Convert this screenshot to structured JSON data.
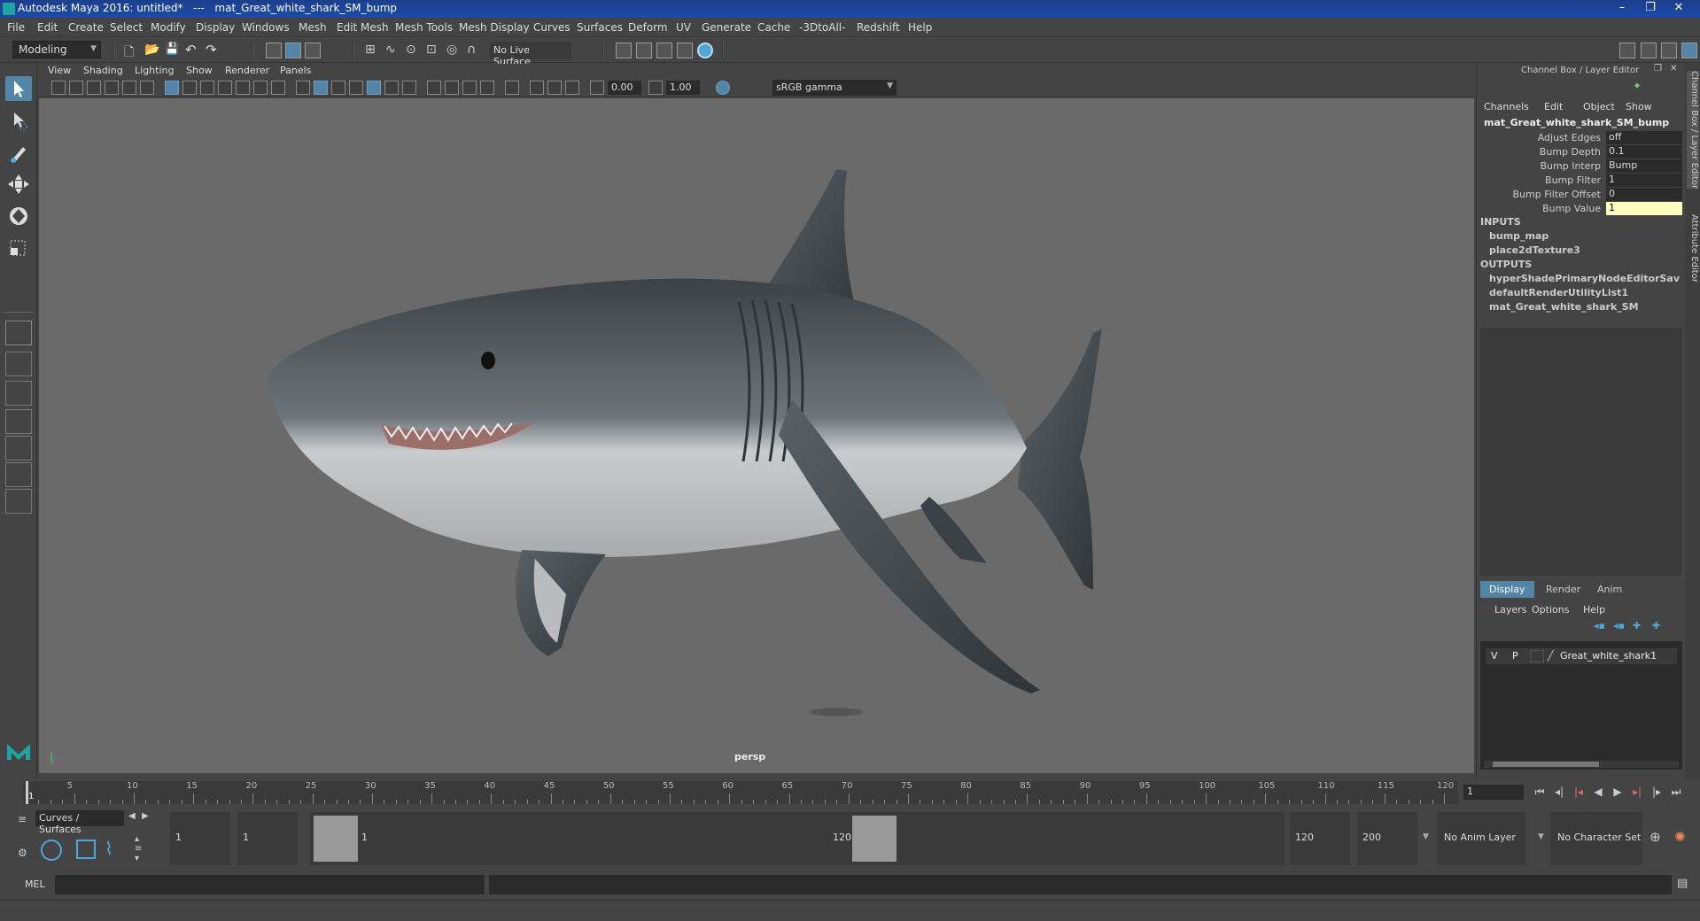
{
  "window": {
    "title": "Autodesk Maya 2016: untitled*   ---   mat_Great_white_shark_SM_bump",
    "minimize": "–",
    "restore": "❐",
    "close": "✕"
  },
  "menubar": [
    "File",
    "Edit",
    "Create",
    "Select",
    "Modify",
    "Display",
    "Windows",
    "Mesh",
    "Edit Mesh",
    "Mesh Tools",
    "Mesh Display",
    "Curves",
    "Surfaces",
    "Deform",
    "UV",
    "Generate",
    "Cache",
    "-3DtoAll-",
    "Redshift",
    "Help"
  ],
  "status": {
    "mode": "Modeling",
    "live_surface": "No Live Surface"
  },
  "panel_menu": [
    "View",
    "Shading",
    "Lighting",
    "Show",
    "Renderer",
    "Panels"
  ],
  "panel_toolbar": {
    "exposure": "0.00",
    "gamma_value": "1.00",
    "color_space": "sRGB gamma"
  },
  "viewport": {
    "camera": "persp"
  },
  "channel_box": {
    "header": "Channel Box / Layer Editor",
    "menu": [
      "Channels",
      "Edit",
      "Object",
      "Show"
    ],
    "node": "mat_Great_white_shark_SM_bump",
    "attributes": [
      {
        "label": "Adjust Edges",
        "value": "off"
      },
      {
        "label": "Bump Depth",
        "value": "0.1"
      },
      {
        "label": "Bump Interp",
        "value": "Bump"
      },
      {
        "label": "Bump Filter",
        "value": "1"
      },
      {
        "label": "Bump Filter Offset",
        "value": "0"
      },
      {
        "label": "Bump Value",
        "value": "1"
      }
    ],
    "inputs_label": "INPUTS",
    "inputs": [
      "bump_map",
      "place2dTexture3"
    ],
    "outputs_label": "OUTPUTS",
    "outputs": [
      "hyperShadePrimaryNodeEditorSavedT...",
      "defaultRenderUtilityList1",
      "mat_Great_white_shark_SM"
    ]
  },
  "layer_editor": {
    "tabs": [
      "Display",
      "Render",
      "Anim"
    ],
    "menu": [
      "Layers",
      "Options",
      "Help"
    ],
    "layer": {
      "v": "V",
      "p": "P",
      "name": "Great_white_shark1"
    }
  },
  "side_tabs": [
    "Channel Box / Layer Editor",
    "Attribute Editor"
  ],
  "timeline": {
    "ticks": [
      "1",
      "5",
      "10",
      "15",
      "20",
      "25",
      "30",
      "35",
      "40",
      "45",
      "50",
      "55",
      "60",
      "65",
      "70",
      "75",
      "80",
      "85",
      "90",
      "95",
      "100",
      "105",
      "110",
      "115",
      "120"
    ],
    "current_frame": "1"
  },
  "range": {
    "shelf_tab": "Curves / Surfaces",
    "start": "1",
    "start_inner": "1",
    "range_start_label": "1",
    "range_end_label": "120",
    "end_inner": "120",
    "end": "200",
    "anim_layer": "No Anim Layer",
    "char_set": "No Character Set"
  },
  "command": {
    "lang": "MEL"
  },
  "colors": {
    "accent": "#5285a6",
    "highlight": "#ffffc0",
    "bg": "#444444",
    "viewport": "#6a6a6a"
  }
}
